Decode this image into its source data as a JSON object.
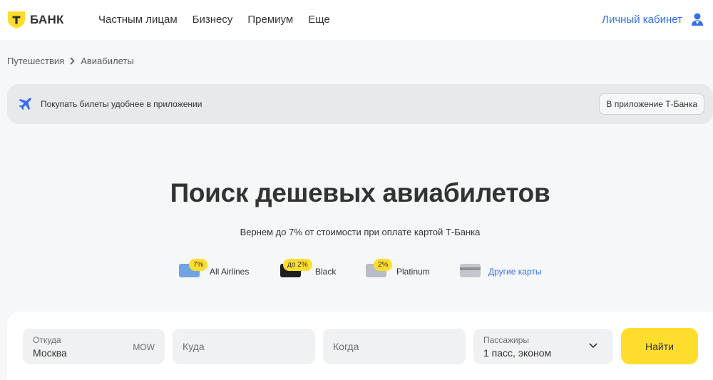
{
  "header": {
    "logo_text": "БАНК",
    "logo_letter": "Т",
    "nav": [
      "Частным лицам",
      "Бизнесу",
      "Премиум",
      "Еще"
    ],
    "account_label": "Личный кабинет",
    "account_icon": "user-icon"
  },
  "breadcrumb": {
    "items": [
      "Путешествия",
      "Авиабилеты"
    ]
  },
  "banner": {
    "icon": "airplane-icon",
    "text": "Покупать билеты удобнее в приложении",
    "button": "В приложение Т-Банка"
  },
  "hero": {
    "title": "Поиск дешевых авиабилетов",
    "subtitle": "Вернем до 7% от стоимости при оплате картой Т-Банка"
  },
  "cards": [
    {
      "badge": "7%",
      "label": "All Airlines",
      "color": "#6fa3e3"
    },
    {
      "badge": "до 2%",
      "label": "Black",
      "color": "#1f1f1f"
    },
    {
      "badge": "2%",
      "label": "Platinum",
      "color": "#b8bcc4"
    },
    {
      "badge": "",
      "label": "Другие карты",
      "color": "#c4c6cb"
    }
  ],
  "search": {
    "from": {
      "label": "Откуда",
      "value": "Москва",
      "code": "MOW"
    },
    "to": {
      "placeholder": "Куда"
    },
    "when": {
      "placeholder": "Когда"
    },
    "passengers": {
      "label": "Пассажиры",
      "value": "1 пасс, эконом"
    },
    "submit": "Найти"
  },
  "colors": {
    "accent_yellow": "#ffdd2d",
    "link_blue": "#336fee",
    "background": "#f6f7f8"
  }
}
